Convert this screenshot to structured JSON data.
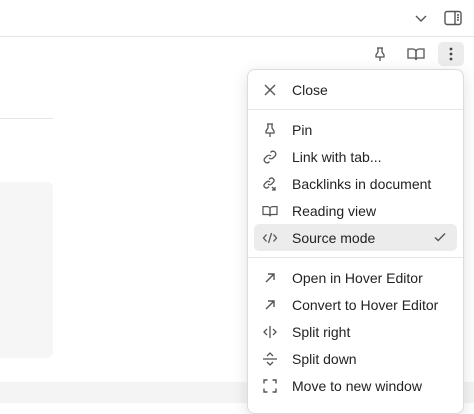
{
  "tabbar": {
    "chevron_icon": "chevron-down-icon",
    "sidebar_icon": "right-sidebar-toggle-icon"
  },
  "view_header": {
    "pin_icon": "pin-icon",
    "reading_icon": "book-open-icon",
    "more_icon": "more-options-icon"
  },
  "menu": {
    "groups": [
      [
        {
          "label": "Close",
          "icon": "x-icon"
        }
      ],
      [
        {
          "label": "Pin",
          "icon": "pin-icon"
        },
        {
          "label": "Link with tab...",
          "icon": "link-icon"
        },
        {
          "label": "Backlinks in document",
          "icon": "backlinks-icon"
        },
        {
          "label": "Reading view",
          "icon": "book-open-icon"
        },
        {
          "label": "Source mode",
          "icon": "code-icon",
          "selected": true
        }
      ],
      [
        {
          "label": "Open in Hover Editor",
          "icon": "arrow-up-right-icon"
        },
        {
          "label": "Convert to Hover Editor",
          "icon": "arrow-up-right-icon"
        },
        {
          "label": "Split right",
          "icon": "split-vertical-icon"
        },
        {
          "label": "Split down",
          "icon": "split-horizontal-icon"
        },
        {
          "label": "Move to new window",
          "icon": "maximize-icon"
        }
      ]
    ]
  }
}
